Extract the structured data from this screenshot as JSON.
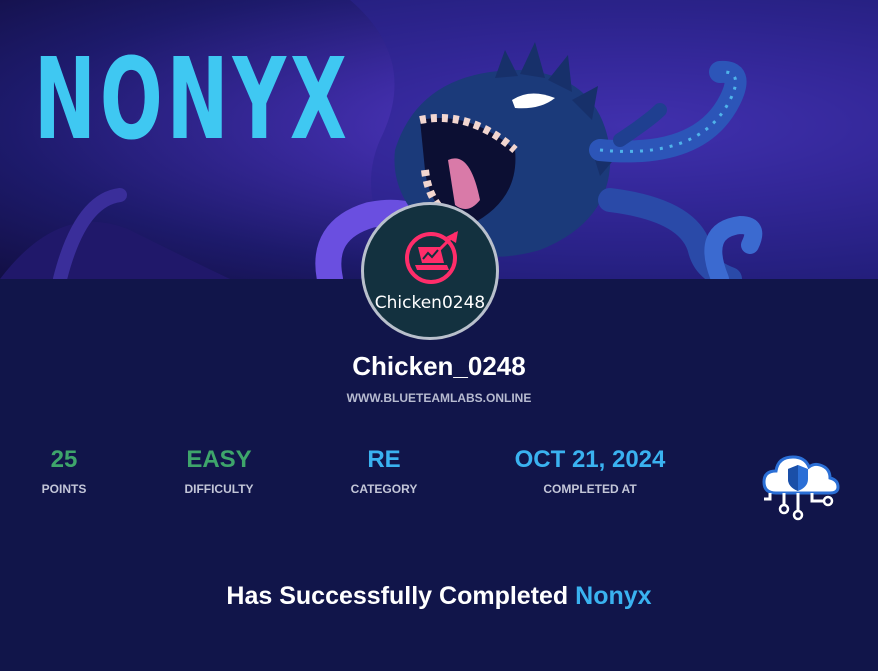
{
  "banner": {
    "title": "NONYX"
  },
  "avatar": {
    "label": "Chicken0248"
  },
  "profile": {
    "username": "Chicken_0248",
    "site": "WWW.BLUETEAMLABS.ONLINE"
  },
  "stats": [
    {
      "value": "25",
      "label": "POINTS",
      "color": "#3ea56b"
    },
    {
      "value": "EASY",
      "label": "DIFFICULTY",
      "color": "#3ea56b"
    },
    {
      "value": "RE",
      "label": "CATEGORY",
      "color": "#3ab2f0"
    },
    {
      "value": "OCT 21, 2024",
      "label": "COMPLETED AT",
      "color": "#3ab2f0"
    }
  ],
  "completion": {
    "prefix": "Has Successfully Completed",
    "challenge": "Nonyx"
  },
  "colors": {
    "background": "#11154a",
    "accent_blue": "#3ab2f0",
    "accent_green": "#3ea56b",
    "banner_title": "#3fc8f2"
  },
  "icons": {
    "avatar_logo": "laptop-target-icon",
    "badge": "cloud-shield-icon"
  }
}
